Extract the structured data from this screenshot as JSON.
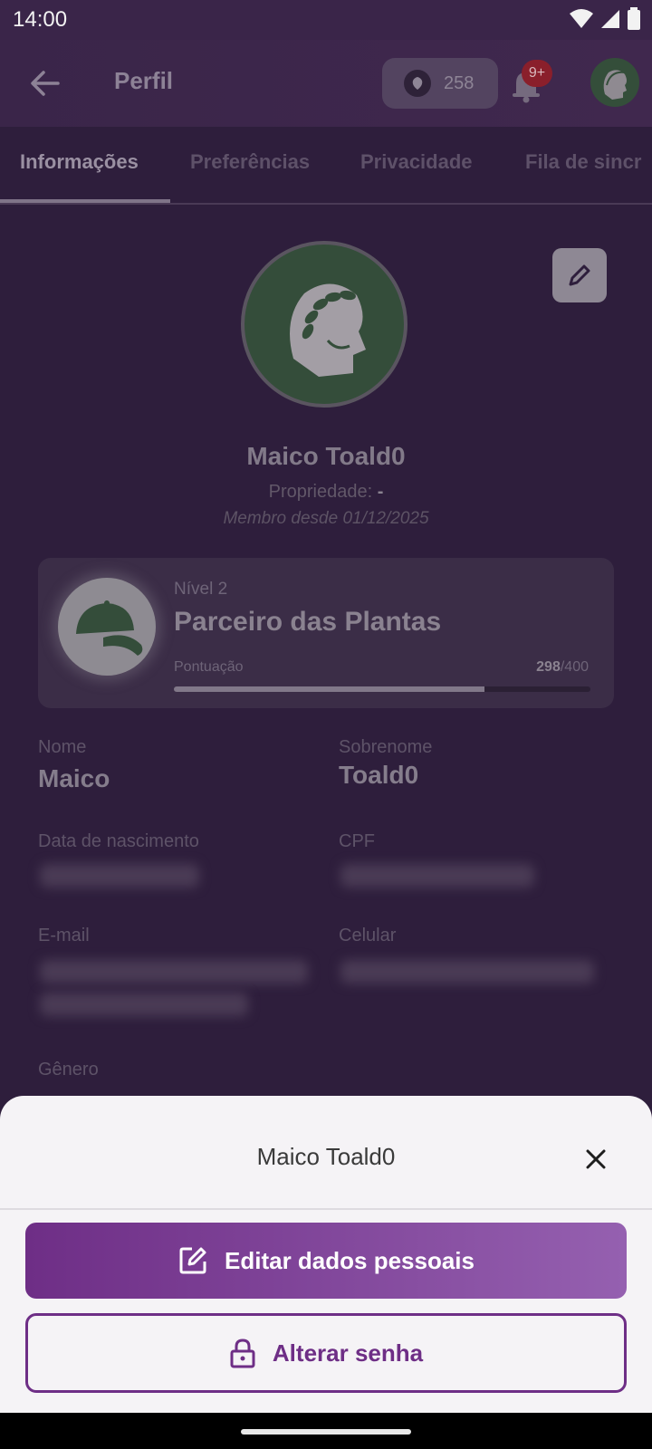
{
  "status_bar": {
    "time": "14:00"
  },
  "app_bar": {
    "title": "Perfil",
    "points": "258",
    "notification_badge": "9+"
  },
  "tabs": [
    {
      "label": "Informações",
      "active": true
    },
    {
      "label": "Preferências",
      "active": false
    },
    {
      "label": "Privacidade",
      "active": false
    },
    {
      "label": "Fila de sincr",
      "active": false
    }
  ],
  "profile": {
    "full_name": "Maico Toald0",
    "property_label": "Propriedade:",
    "property_value": "-",
    "member_since": "Membro desde 01/12/2025"
  },
  "level": {
    "level_label": "Nível 2",
    "name": "Parceiro das Plantas",
    "score_label": "Pontuação",
    "score_current": "298",
    "score_max": "/400",
    "progress_fraction": 0.745
  },
  "fields": {
    "first_name_label": "Nome",
    "first_name_value": "Maico",
    "last_name_label": "Sobrenome",
    "last_name_value": "Toald0",
    "birth_label": "Data de nascimento",
    "cpf_label": "CPF",
    "email_label": "E-mail",
    "phone_label": "Celular",
    "gender_label": "Gênero"
  },
  "sheet": {
    "title": "Maico Toald0",
    "edit_button": "Editar dados pessoais",
    "password_button": "Alterar senha"
  },
  "colors": {
    "accent": "#6e2e86",
    "accent_light": "#9560b0",
    "badge": "#c62828"
  }
}
